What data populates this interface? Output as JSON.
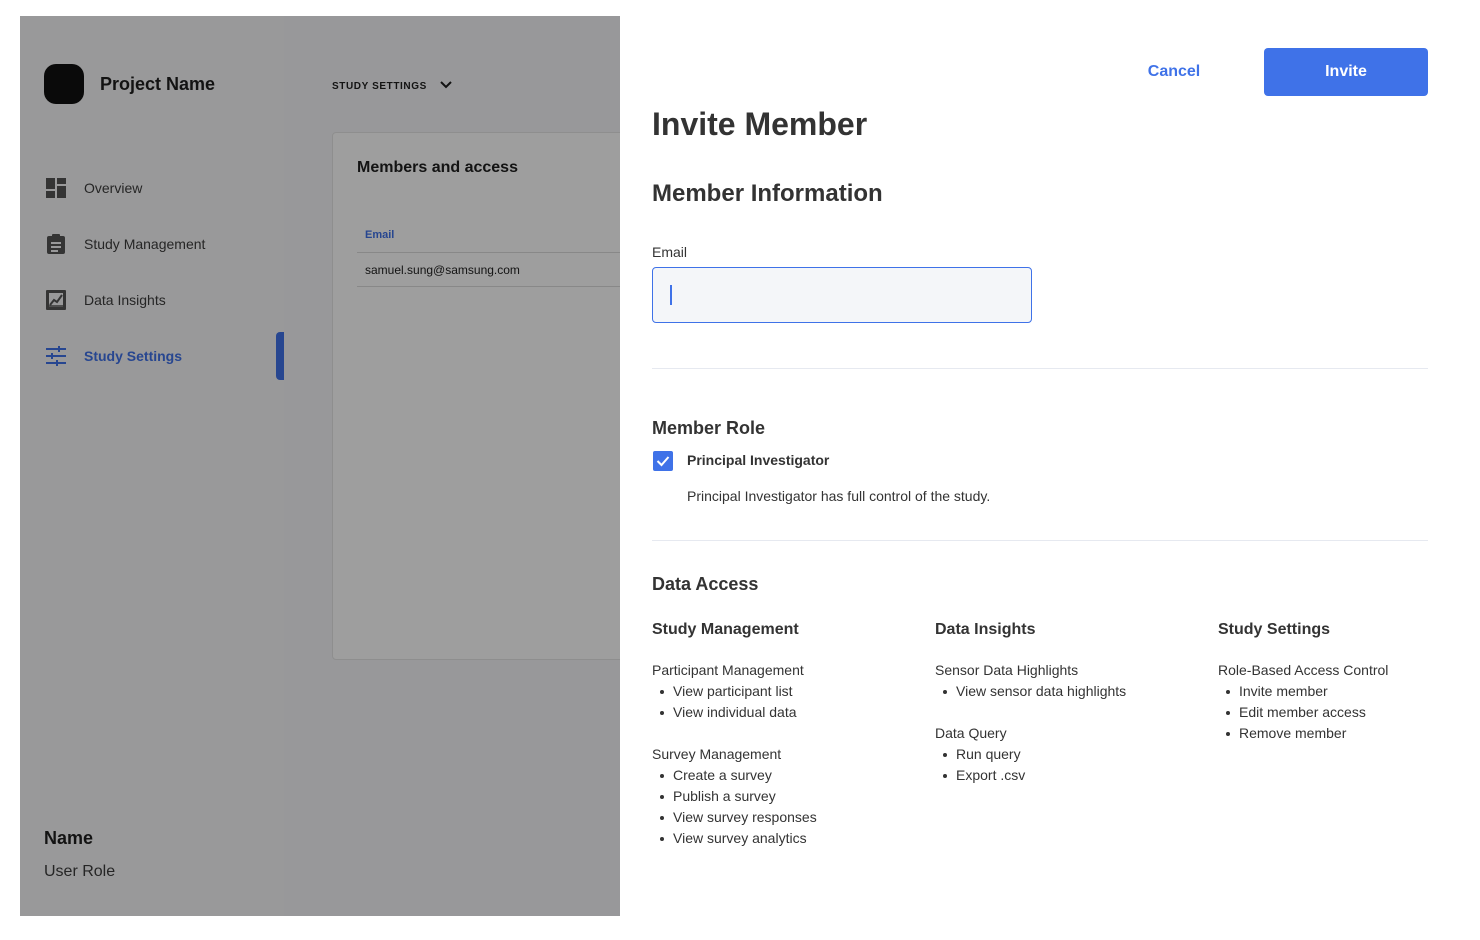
{
  "sidebar": {
    "project_name": "Project Name",
    "items": [
      {
        "label": "Overview",
        "icon": "dashboard-icon"
      },
      {
        "label": "Study Management",
        "icon": "clipboard-icon"
      },
      {
        "label": "Data Insights",
        "icon": "chart-icon"
      },
      {
        "label": "Study Settings",
        "icon": "sliders-icon",
        "active": true
      }
    ],
    "user": {
      "name": "Name",
      "role": "User Role"
    }
  },
  "main": {
    "breadcrumb": "STUDY SETTINGS",
    "card_title": "Members and access",
    "table": {
      "headers": [
        "Email"
      ],
      "rows": [
        [
          "samuel.sung@samsung.com"
        ]
      ]
    }
  },
  "drawer": {
    "cancel_label": "Cancel",
    "invite_label": "Invite",
    "title": "Invite Member",
    "member_info_title": "Member Information",
    "email_label": "Email",
    "email_value": "",
    "role_title": "Member Role",
    "role_option_label": "Principal Investigator",
    "role_option_checked": true,
    "role_description": "Principal Investigator has full control of the study.",
    "data_access_title": "Data Access",
    "columns": [
      {
        "title": "Study Management",
        "groups": [
          {
            "title": "Participant Management",
            "items": [
              "View participant list",
              "View individual data"
            ]
          },
          {
            "title": "Survey Management",
            "items": [
              "Create a survey",
              "Publish a survey",
              "View survey responses",
              "View survey analytics"
            ]
          }
        ]
      },
      {
        "title": "Data Insights",
        "groups": [
          {
            "title": "Sensor Data Highlights",
            "items": [
              "View sensor data highlights"
            ]
          },
          {
            "title": "Data Query",
            "items": [
              "Run query",
              "Export .csv"
            ]
          }
        ]
      },
      {
        "title": "Study Settings",
        "groups": [
          {
            "title": "Role-Based Access Control",
            "items": [
              "Invite member",
              "Edit member access",
              "Remove member"
            ]
          }
        ]
      }
    ]
  },
  "colors": {
    "accent": "#3f72e8",
    "overlay": "rgba(0,0,0,0.38)"
  }
}
